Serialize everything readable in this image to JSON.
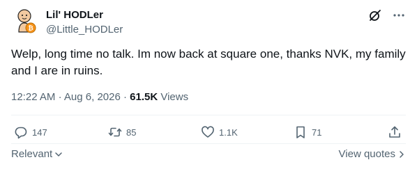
{
  "author": {
    "display_name": "Lil' HODLer",
    "handle": "@Little_HODLer"
  },
  "tweet": {
    "text": "Welp, long time no talk. Im now back at square one, thanks NVK, my family and I are in ruins."
  },
  "meta": {
    "time": "12:22 AM",
    "separator": "·",
    "date": "Aug 6, 2026",
    "views_count": "61.5K",
    "views_label": "Views"
  },
  "actions": {
    "replies": "147",
    "reposts": "85",
    "likes": "1.1K",
    "bookmarks": "71"
  },
  "footer": {
    "sort_label": "Relevant",
    "view_quotes_label": "View quotes"
  },
  "icons": {
    "avatar": "avatar-icon",
    "grok": "grok-icon",
    "more": "more-icon",
    "reply": "reply-icon",
    "repost": "repost-icon",
    "like": "heart-icon",
    "bookmark": "bookmark-icon",
    "share": "share-icon"
  },
  "colors": {
    "primary_text": "#0f1419",
    "secondary_text": "#536471",
    "divider": "#eff3f4",
    "avatar_skin": "#f2c9a0",
    "bitcoin_orange": "#f7931a"
  }
}
